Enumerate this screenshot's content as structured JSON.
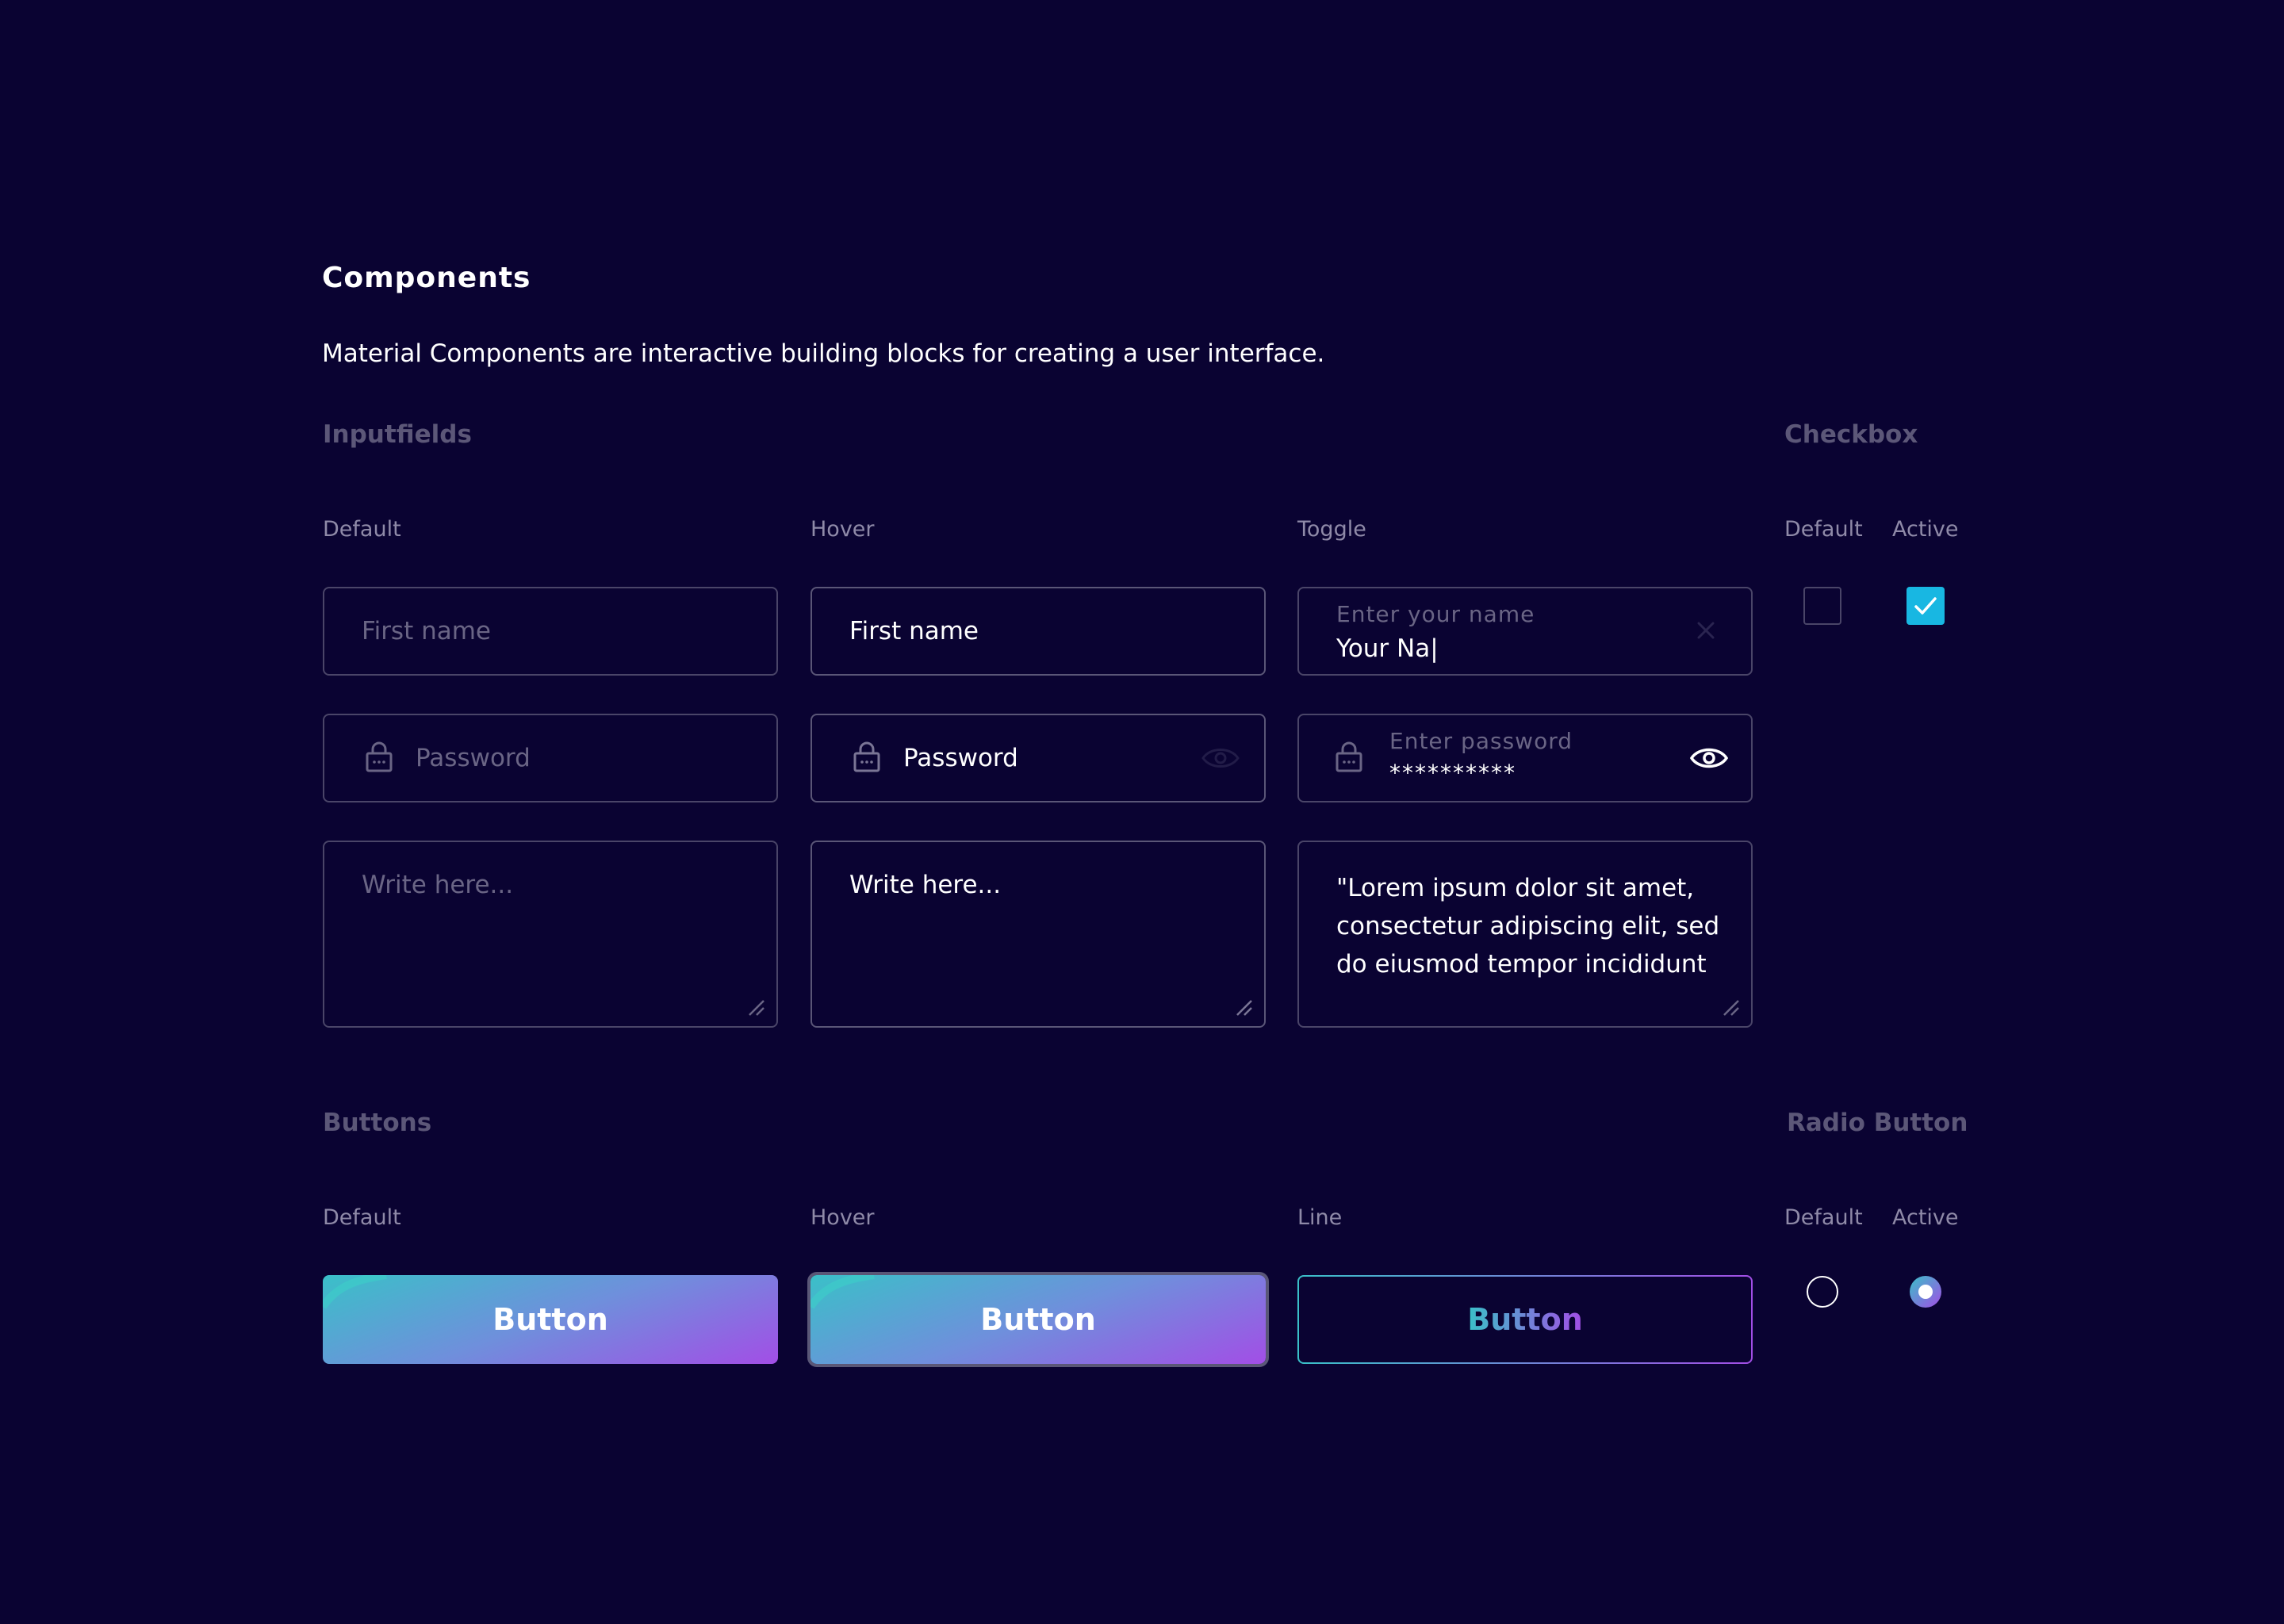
{
  "page": {
    "title": "Components",
    "description": "Material Components are interactive building blocks for creating a user interface."
  },
  "inputfields": {
    "heading": "Inputfields",
    "columns": [
      "Default",
      "Hover",
      "Toggle"
    ],
    "default": {
      "name_placeholder": "First name",
      "password_placeholder": "Password",
      "textarea_placeholder": "Write here..."
    },
    "hover": {
      "name_text": "First name",
      "password_text": "Password",
      "textarea_text": "Write here..."
    },
    "toggle": {
      "name_label": "Enter your name",
      "name_value": "Your Na|",
      "password_label": "Enter password",
      "password_value": "**********",
      "textarea_value": "\"Lorem ipsum dolor sit amet, consectetur adipiscing elit, sed do eiusmod tempor incididunt"
    }
  },
  "checkbox": {
    "heading": "Checkbox",
    "labels": [
      "Default",
      "Active"
    ],
    "active_color": "#18b7e2"
  },
  "buttons": {
    "heading": "Buttons",
    "columns": [
      "Default",
      "Hover",
      "Line"
    ],
    "label": "Button"
  },
  "radio": {
    "heading": "Radio Button",
    "labels": [
      "Default",
      "Active"
    ]
  },
  "colors": {
    "background": "#0a0332",
    "gradient_start": "#3ac0c8",
    "gradient_end": "#a24ee6"
  }
}
